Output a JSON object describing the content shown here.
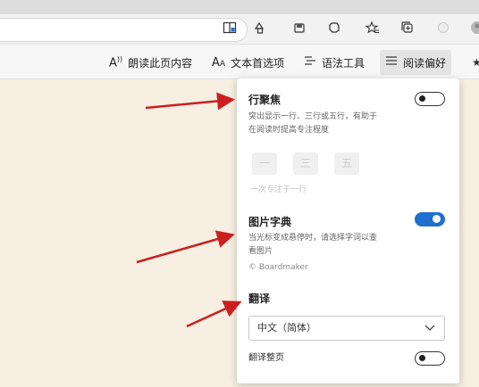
{
  "reader_toolbar": {
    "read_aloud": "朗读此页内容",
    "text_prefs": "文本首选项",
    "grammar_tools": "语法工具",
    "reading_prefs": "阅读偏好"
  },
  "panel": {
    "line_focus": {
      "title": "行聚焦",
      "description_line1": "突出显示一行、三行或五行，有助于",
      "description_line2": "在阅读时提高专注程度",
      "enabled": false,
      "options": [
        "一",
        "三",
        "五"
      ],
      "hint": "一次专注于一行"
    },
    "picture_dictionary": {
      "title": "图片字典",
      "description_line1": "当光标变成悬停时，请选择字词以查",
      "description_line2": "看图片",
      "credit": "© Boardmaker",
      "enabled": true
    },
    "translate": {
      "title": "翻译",
      "selected_language": "中文（简体）",
      "translate_page_label": "翻译整页",
      "translate_page_enabled": false
    }
  },
  "colors": {
    "page_background": "#f6efe2",
    "toggle_on": "#1f6fd1",
    "annotation_arrow": "#cc1f1f"
  }
}
